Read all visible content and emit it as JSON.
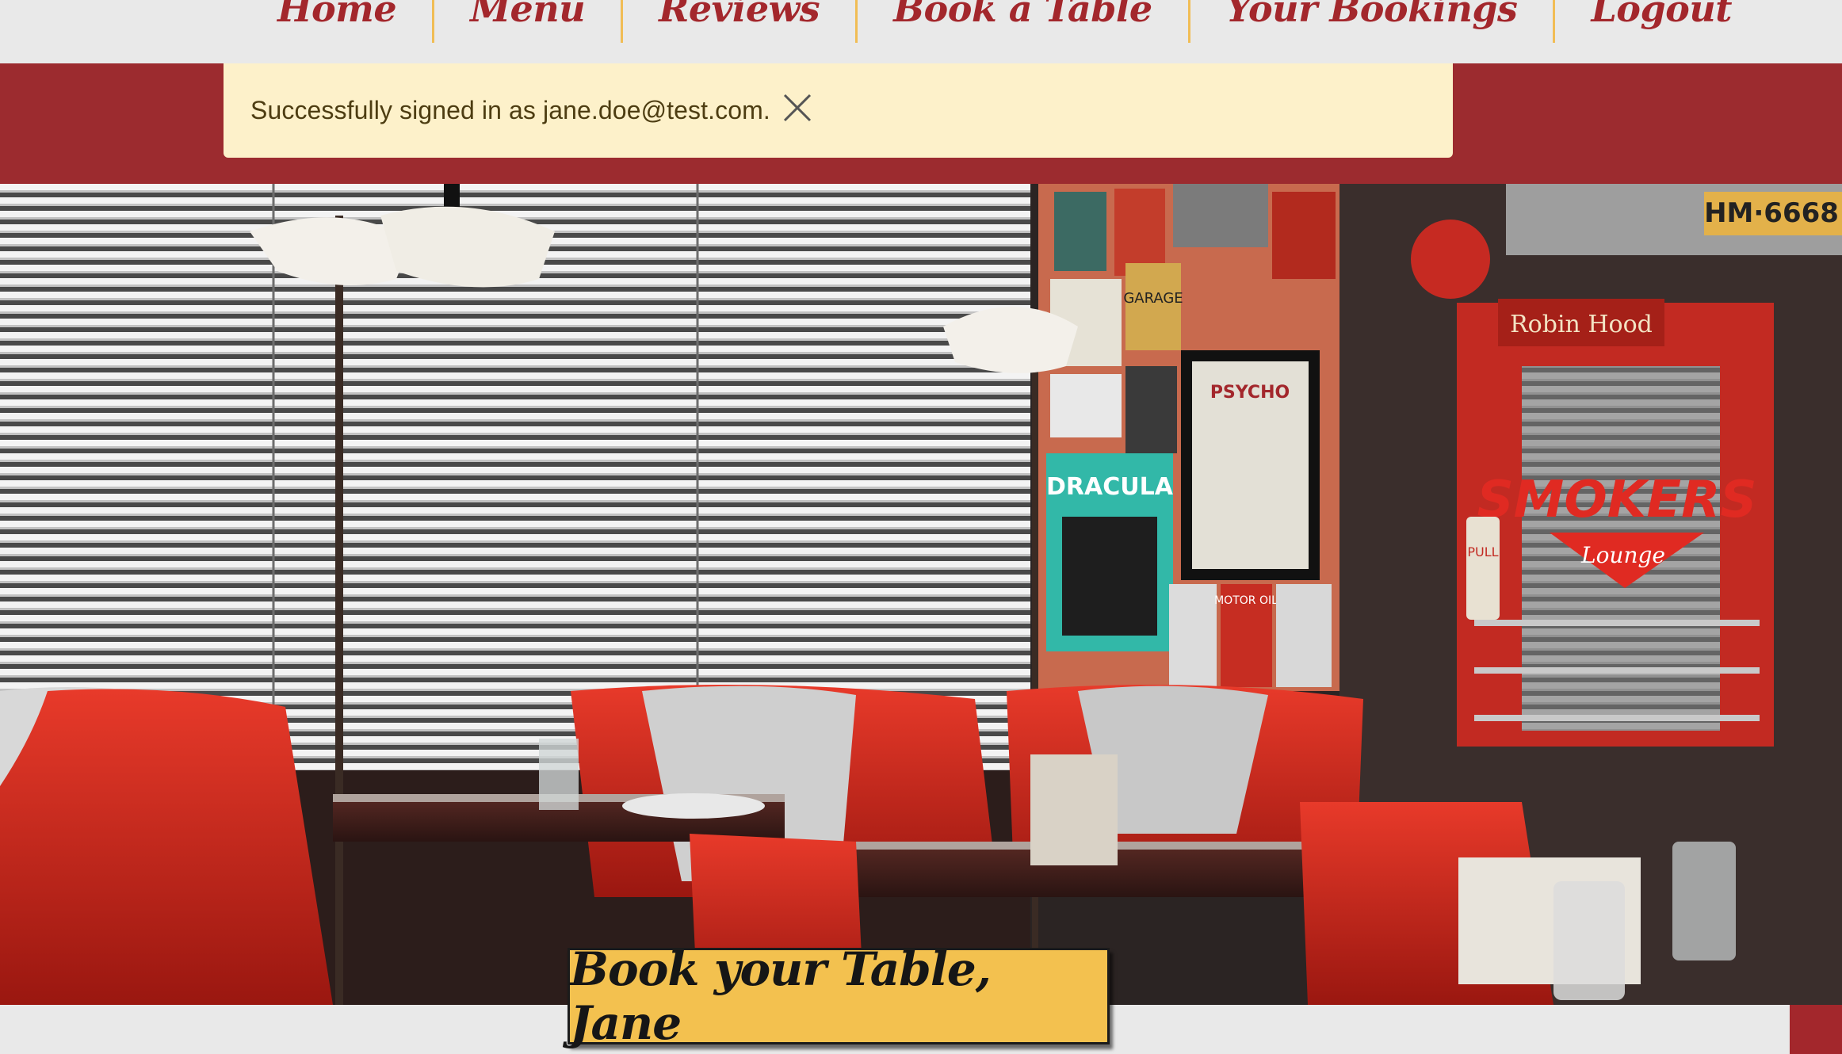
{
  "nav": {
    "items": [
      {
        "label": "Home"
      },
      {
        "label": "Menu"
      },
      {
        "label": "Reviews"
      },
      {
        "label": "Book a Table"
      },
      {
        "label": "Your Bookings"
      },
      {
        "label": "Logout"
      }
    ]
  },
  "alert": {
    "message": "Successfully signed in as jane.doe@test.com.",
    "close_icon": "close-icon"
  },
  "hero": {
    "image_description_icon": "diner-interior-photo",
    "sign_smokers": "SMOKERS",
    "sign_lounge": "Lounge",
    "sign_robinhood": "Robin Hood",
    "sign_pull": "PULL",
    "poster_psycho": "PSYCHO",
    "poster_dracula": "DRACULA",
    "poster_garage": "GARAGE",
    "poster_motoroil": "MOTOR OIL",
    "plate": "HM·6668"
  },
  "cta": {
    "label": "Book your Table, Jane"
  },
  "colors": {
    "brand_red": "#9c2b2f",
    "nav_text": "#a3272c",
    "accent_yellow": "#f3c14f",
    "alert_bg": "#fdf1ca",
    "divider": "#f1bd55"
  }
}
